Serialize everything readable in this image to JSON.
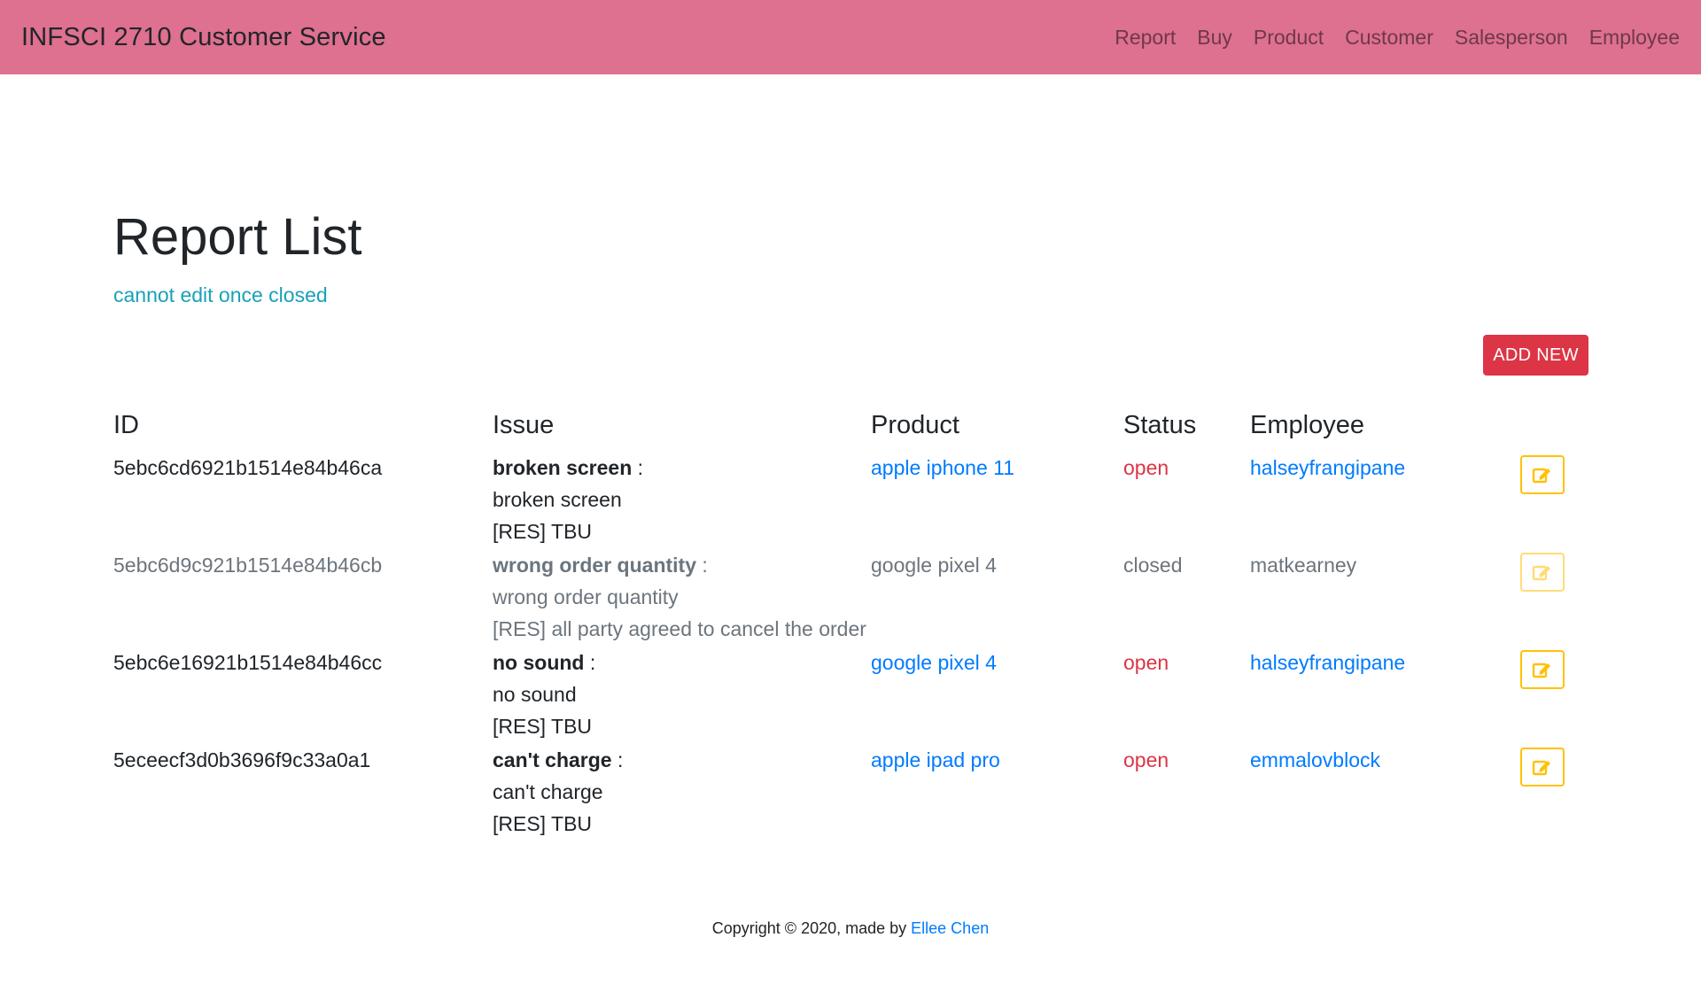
{
  "navbar": {
    "brand": "INFSCI 2710 Customer Service",
    "links": [
      "Report",
      "Buy",
      "Product",
      "Customer",
      "Salesperson",
      "Employee"
    ]
  },
  "page": {
    "title": "Report List",
    "subtitle": "cannot edit once closed",
    "add_button": "ADD NEW"
  },
  "table": {
    "headers": [
      "ID",
      "Issue",
      "Product",
      "Status",
      "Employee"
    ],
    "rows": [
      {
        "id": "5ebc6cd6921b1514e84b46ca",
        "issue_title": "broken screen",
        "issue_desc": "broken screen",
        "resolution": "[RES] TBU",
        "product": "apple iphone 11",
        "status": "open",
        "employee": "halseyfrangipane"
      },
      {
        "id": "5ebc6d9c921b1514e84b46cb",
        "issue_title": "wrong order quantity",
        "issue_desc": "wrong order quantity",
        "resolution": "[RES] all party agreed to cancel the order",
        "product": "google pixel 4",
        "status": "closed",
        "employee": "matkearney"
      },
      {
        "id": "5ebc6e16921b1514e84b46cc",
        "issue_title": "no sound",
        "issue_desc": "no sound",
        "resolution": "[RES] TBU",
        "product": "google pixel 4",
        "status": "open",
        "employee": "halseyfrangipane"
      },
      {
        "id": "5eceecf3d0b3696f9c33a0a1",
        "issue_title": "can't charge",
        "issue_desc": "can't charge",
        "resolution": "[RES] TBU",
        "product": "apple ipad pro",
        "status": "open",
        "employee": "emmalovblock"
      }
    ],
    "issue_separator": " :",
    "edit_icon": "edit-icon"
  },
  "footer": {
    "text": "Copyright © 2020, made by ",
    "author": "Ellee Chen"
  },
  "colors": {
    "navbar": "#de7090",
    "subtitle": "#17a2b8",
    "add_button": "#dc3545",
    "link": "#007bff",
    "open": "#dc3545",
    "closed": "#28a745",
    "edit_border": "#ffc107"
  }
}
